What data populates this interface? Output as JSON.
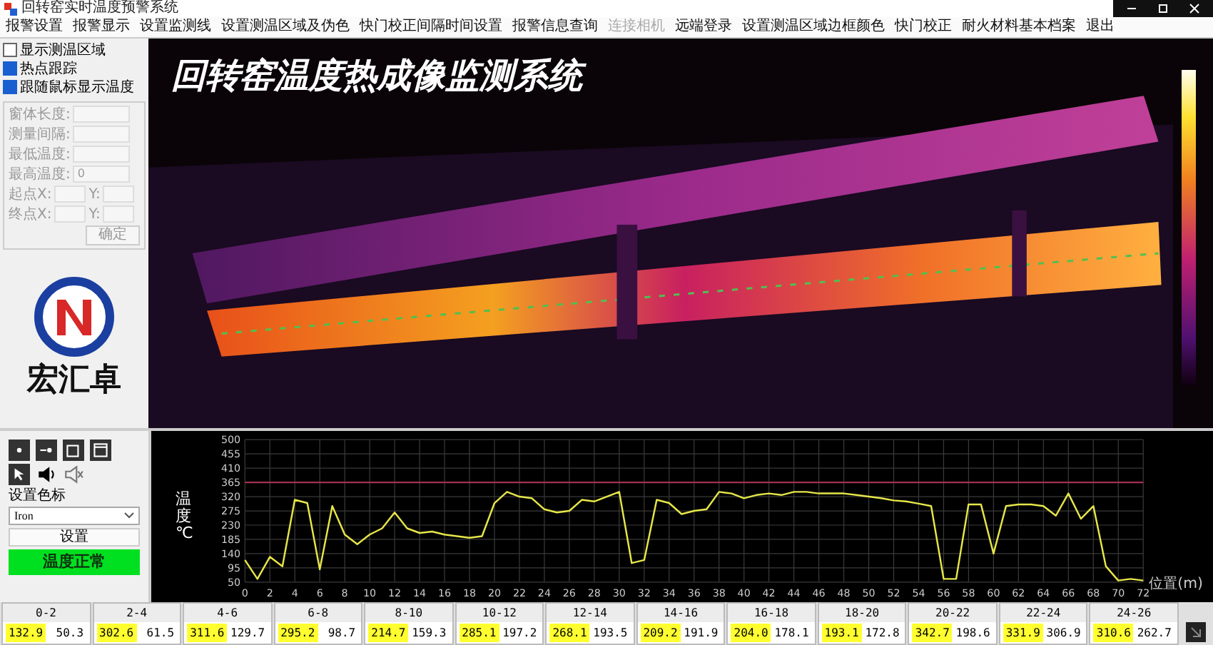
{
  "window": {
    "title": "回转窑实时温度预警系统"
  },
  "menu": [
    {
      "label": "报警设置",
      "disabled": false
    },
    {
      "label": "报警显示",
      "disabled": false
    },
    {
      "label": "设置监测线",
      "disabled": false
    },
    {
      "label": "设置测温区域及伪色",
      "disabled": false
    },
    {
      "label": "快门校正间隔时间设置",
      "disabled": false
    },
    {
      "label": "报警信息查询",
      "disabled": false
    },
    {
      "label": "连接相机",
      "disabled": true
    },
    {
      "label": "远端登录",
      "disabled": false
    },
    {
      "label": "设置测温区域边框颜色",
      "disabled": false
    },
    {
      "label": "快门校正",
      "disabled": false
    },
    {
      "label": "耐火材料基本档案",
      "disabled": false
    },
    {
      "label": "退出",
      "disabled": false
    }
  ],
  "options": [
    {
      "label": "显示测温区域",
      "checked": false
    },
    {
      "label": "热点跟踪",
      "checked": true
    },
    {
      "label": "跟随鼠标显示温度",
      "checked": true
    }
  ],
  "region_form": {
    "disabled": true,
    "fields": [
      {
        "kind": "single",
        "label": "窗体长度:"
      },
      {
        "kind": "single",
        "label": "测量间隔:"
      },
      {
        "kind": "single",
        "label": "最低温度:"
      },
      {
        "kind": "single",
        "label": "最高温度:",
        "value": "0"
      },
      {
        "kind": "pair",
        "label": "起点X:",
        "label2": "Y:"
      },
      {
        "kind": "pair",
        "label": "终点X:",
        "label2": "Y:"
      }
    ],
    "button": "确定"
  },
  "logo": {
    "text": "宏汇卓"
  },
  "camera": {
    "title": "回转窑温度热成像监测系统"
  },
  "controls": {
    "palette_label": "设置色标",
    "palette": "Iron",
    "apply_button": "设置",
    "status": {
      "text": "温度正常",
      "alarm": false
    }
  },
  "chart": {
    "chart_data": {
      "type": "line",
      "xlabel": "位置(m)",
      "ylabel": "温度℃",
      "xlim": [
        0,
        72
      ],
      "ylim": [
        50,
        500
      ],
      "xticks": [
        0,
        2,
        4,
        6,
        8,
        10,
        12,
        14,
        16,
        18,
        20,
        22,
        24,
        26,
        28,
        30,
        32,
        34,
        36,
        38,
        40,
        42,
        44,
        46,
        48,
        50,
        52,
        54,
        56,
        58,
        60,
        62,
        64,
        66,
        68,
        70,
        72
      ],
      "yticks": [
        50,
        95,
        140,
        185,
        230,
        275,
        320,
        365,
        410,
        455,
        500
      ],
      "x": [
        0,
        1,
        2,
        3,
        4,
        5,
        6,
        7,
        8,
        9,
        10,
        11,
        12,
        13,
        14,
        15,
        16,
        17,
        18,
        19,
        20,
        21,
        22,
        23,
        24,
        25,
        26,
        27,
        28,
        29,
        30,
        31,
        32,
        33,
        34,
        35,
        36,
        37,
        38,
        39,
        40,
        41,
        42,
        43,
        44,
        45,
        46,
        47,
        48,
        49,
        50,
        51,
        52,
        53,
        54,
        55,
        56,
        57,
        58,
        59,
        60,
        61,
        62,
        63,
        64,
        65,
        66,
        67,
        68,
        69,
        70,
        71,
        72
      ],
      "series": [
        {
          "color": "#e6e64a",
          "values": [
            120,
            60,
            130,
            100,
            310,
            300,
            90,
            290,
            200,
            170,
            200,
            220,
            270,
            220,
            205,
            210,
            200,
            195,
            190,
            195,
            300,
            335,
            320,
            315,
            280,
            270,
            275,
            310,
            305,
            320,
            335,
            110,
            120,
            310,
            300,
            265,
            275,
            280,
            335,
            330,
            315,
            325,
            330,
            325,
            335,
            335,
            330,
            330,
            330,
            325,
            320,
            315,
            308,
            305,
            298,
            290,
            60,
            60,
            295,
            295,
            140,
            290,
            295,
            295,
            290,
            260,
            330,
            250,
            290,
            100,
            55,
            60,
            55
          ]
        },
        {
          "color": "#a03050",
          "values": [
            365,
            365,
            365,
            365,
            365,
            365,
            365,
            365,
            365,
            365,
            365,
            365,
            365,
            365,
            365,
            365,
            365,
            365,
            365,
            365,
            365,
            365,
            365,
            365,
            365,
            365,
            365,
            365,
            365,
            365,
            365,
            365,
            365,
            365,
            365,
            365,
            365,
            365,
            365,
            365,
            365,
            365,
            365,
            365,
            365,
            365,
            365,
            365,
            365,
            365,
            365,
            365,
            365,
            365,
            365,
            365,
            365,
            365,
            365,
            365,
            365,
            365,
            365,
            365,
            365,
            365,
            365,
            365,
            365,
            365,
            365,
            365,
            365
          ]
        }
      ],
      "grid": true
    }
  },
  "zones": [
    {
      "range": "0-2",
      "max": "132.9",
      "min": "50.3"
    },
    {
      "range": "2-4",
      "max": "302.6",
      "min": "61.5"
    },
    {
      "range": "4-6",
      "max": "311.6",
      "min": "129.7"
    },
    {
      "range": "6-8",
      "max": "295.2",
      "min": "98.7"
    },
    {
      "range": "8-10",
      "max": "214.7",
      "min": "159.3"
    },
    {
      "range": "10-12",
      "max": "285.1",
      "min": "197.2"
    },
    {
      "range": "12-14",
      "max": "268.1",
      "min": "193.5"
    },
    {
      "range": "14-16",
      "max": "209.2",
      "min": "191.9"
    },
    {
      "range": "16-18",
      "max": "204.0",
      "min": "178.1"
    },
    {
      "range": "18-20",
      "max": "193.1",
      "min": "172.8"
    },
    {
      "range": "20-22",
      "max": "342.7",
      "min": "198.6"
    },
    {
      "range": "22-24",
      "max": "331.9",
      "min": "306.9"
    },
    {
      "range": "24-26",
      "max": "310.6",
      "min": "262.7"
    }
  ]
}
